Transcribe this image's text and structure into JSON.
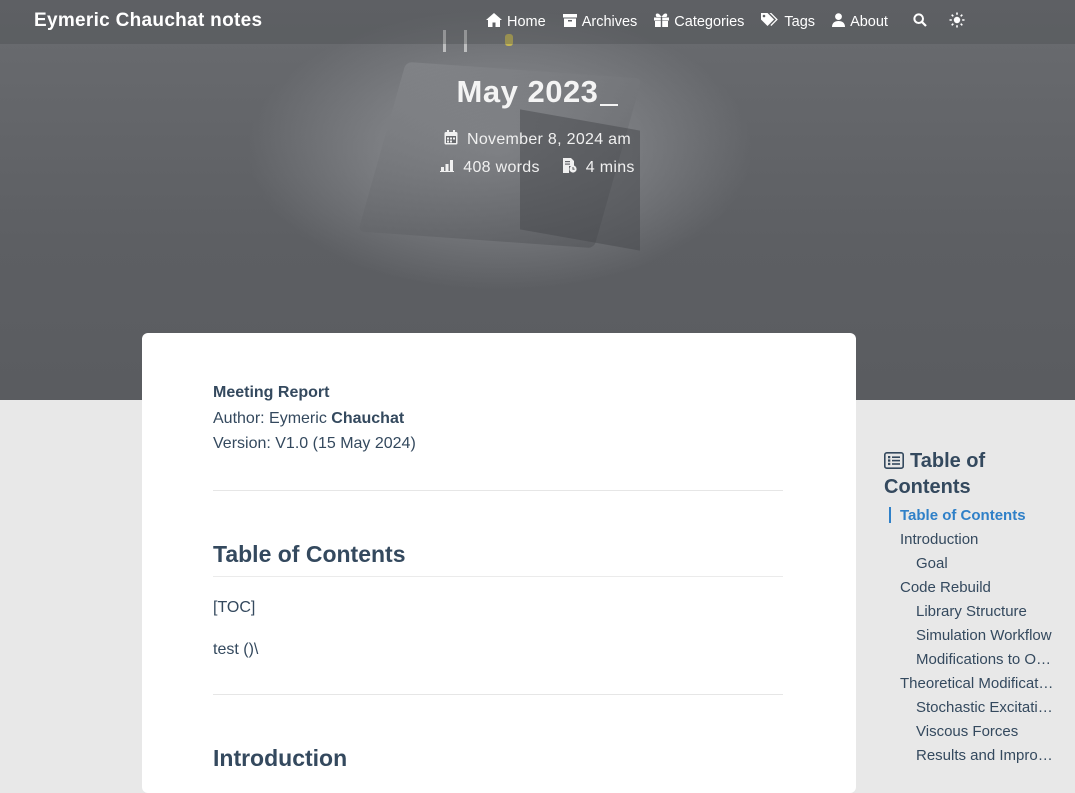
{
  "site": {
    "brand": "Eymeric Chauchat notes"
  },
  "nav": {
    "items": [
      {
        "label": "Home",
        "icon": "home-icon"
      },
      {
        "label": "Archives",
        "icon": "archive-icon"
      },
      {
        "label": "Categories",
        "icon": "categories-icon"
      },
      {
        "label": "Tags",
        "icon": "tags-icon"
      },
      {
        "label": "About",
        "icon": "user-icon"
      }
    ],
    "search_icon": "search-icon",
    "theme_icon": "sun-icon"
  },
  "post": {
    "title": "May 2023",
    "date": "November 8, 2024 am",
    "words": "408 words",
    "read_time": "4 mins"
  },
  "article": {
    "report_label": "Meeting Report",
    "author_prefix": "Author: Eymeric ",
    "author_bold": "Chauchat",
    "version": "Version: V1.0 (15 May 2024)",
    "h_toc": "Table of Contents",
    "toc_placeholder": "[TOC]",
    "test_line": "test ()\\",
    "h_intro": "Introduction"
  },
  "toc": {
    "heading": "Table of Contents",
    "items": [
      {
        "label": "Table of Contents"
      },
      {
        "label": "Introduction"
      },
      {
        "label": "Goal"
      },
      {
        "label": "Code Rebuild"
      },
      {
        "label": "Library Structure"
      },
      {
        "label": "Simulation Workflow"
      },
      {
        "label": "Modifications to O…"
      },
      {
        "label": "Theoretical Modificat…"
      },
      {
        "label": "Stochastic Excitati…"
      },
      {
        "label": "Viscous Forces"
      },
      {
        "label": "Results and Impro…"
      }
    ],
    "active_index": 0
  },
  "colors": {
    "accent": "#2f80c8",
    "text": "#34495e",
    "card": "#ffffff",
    "page_bg": "#e8e8e8"
  }
}
